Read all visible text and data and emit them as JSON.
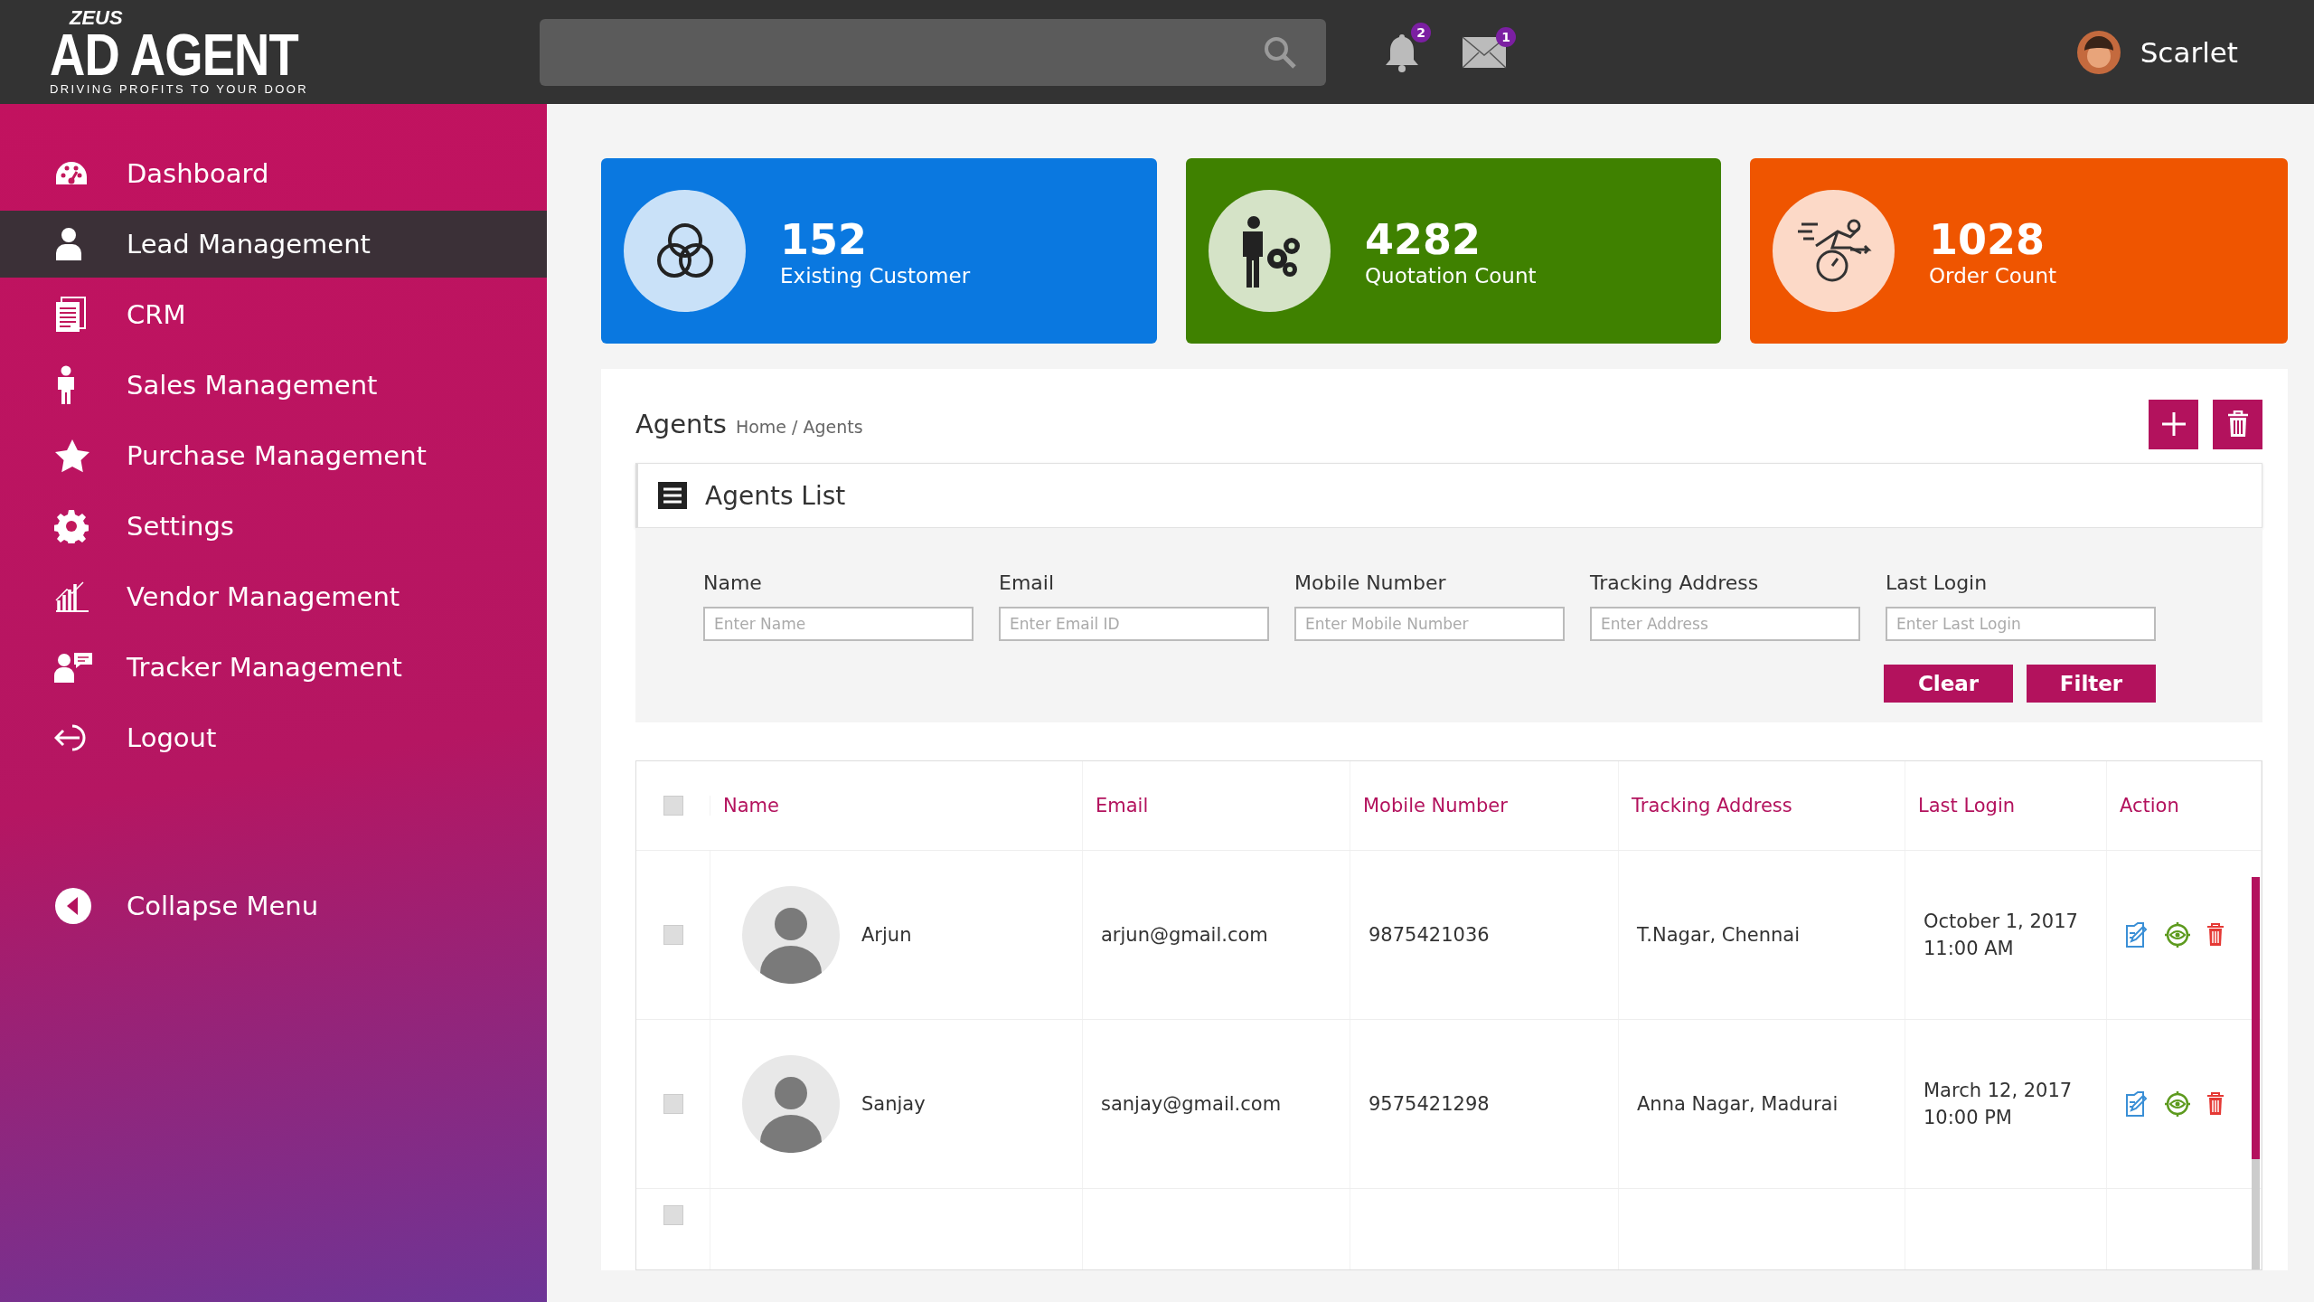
{
  "header": {
    "logo": {
      "top": "ZEUS",
      "name_left": "AD",
      "name_right": "AGENT",
      "tagline": "DRIVING PROFITS TO YOUR DOOR"
    },
    "notifications": {
      "badge": "2"
    },
    "messages": {
      "badge": "1"
    },
    "user": {
      "name": "Scarlet"
    }
  },
  "sidebar": {
    "items": [
      {
        "kind": "dashboard",
        "label": "Dashboard",
        "selected": false
      },
      {
        "kind": "user",
        "label": "Lead Management",
        "selected": true
      },
      {
        "kind": "document",
        "label": "CRM",
        "selected": false
      },
      {
        "kind": "person",
        "label": "Sales Management",
        "selected": false
      },
      {
        "kind": "star",
        "label": "Purchase Management",
        "selected": false
      },
      {
        "kind": "gear",
        "label": "Settings",
        "selected": false
      },
      {
        "kind": "chart",
        "label": "Vendor Management",
        "selected": false
      },
      {
        "kind": "chat",
        "label": "Tracker Management",
        "selected": false
      },
      {
        "kind": "logout",
        "label": "Logout",
        "selected": false
      }
    ],
    "collapse": "Collapse Menu"
  },
  "stats": [
    {
      "kind": "circles",
      "value": "152",
      "label": "Existing Customer",
      "color": "#0a78e0"
    },
    {
      "kind": "worker",
      "value": "4282",
      "label": "Quotation Count",
      "color": "#3f8100"
    },
    {
      "kind": "runner",
      "value": "1028",
      "label": "Order Count",
      "color": "#ef5500"
    }
  ],
  "agents": {
    "title": "Agents",
    "breadcrumb": "Home / Agents",
    "list_title": "Agents List",
    "filters": [
      {
        "label": "Name",
        "placeholder": "Enter Name"
      },
      {
        "label": "Email",
        "placeholder": "Enter Email ID"
      },
      {
        "label": "Mobile Number",
        "placeholder": "Enter Mobile Number"
      },
      {
        "label": "Tracking Address",
        "placeholder": "Enter Address"
      },
      {
        "label": "Last Login",
        "placeholder": "Enter Last Login"
      }
    ],
    "buttons": [
      "Clear",
      "Filter"
    ],
    "table": {
      "select_all": {
        "checked": false
      },
      "columns": [
        "Name",
        "Email",
        "Mobile Number",
        "Tracking Address",
        "Last Login",
        "Action"
      ],
      "rows": [
        {
          "checked": false,
          "name": "Arjun",
          "email": "arjun@gmail.com",
          "mobile": "9875421036",
          "address": "T.Nagar, Chennai",
          "date": "October 1, 2017",
          "time": "11:00 AM"
        },
        {
          "checked": false,
          "name": "Sanjay",
          "email": "sanjay@gmail.com",
          "mobile": "9575421298",
          "address": "Anna Nagar, Madurai",
          "date": "March 12, 2017",
          "time": "10:00 PM"
        },
        {
          "checked": false
        }
      ]
    }
  }
}
